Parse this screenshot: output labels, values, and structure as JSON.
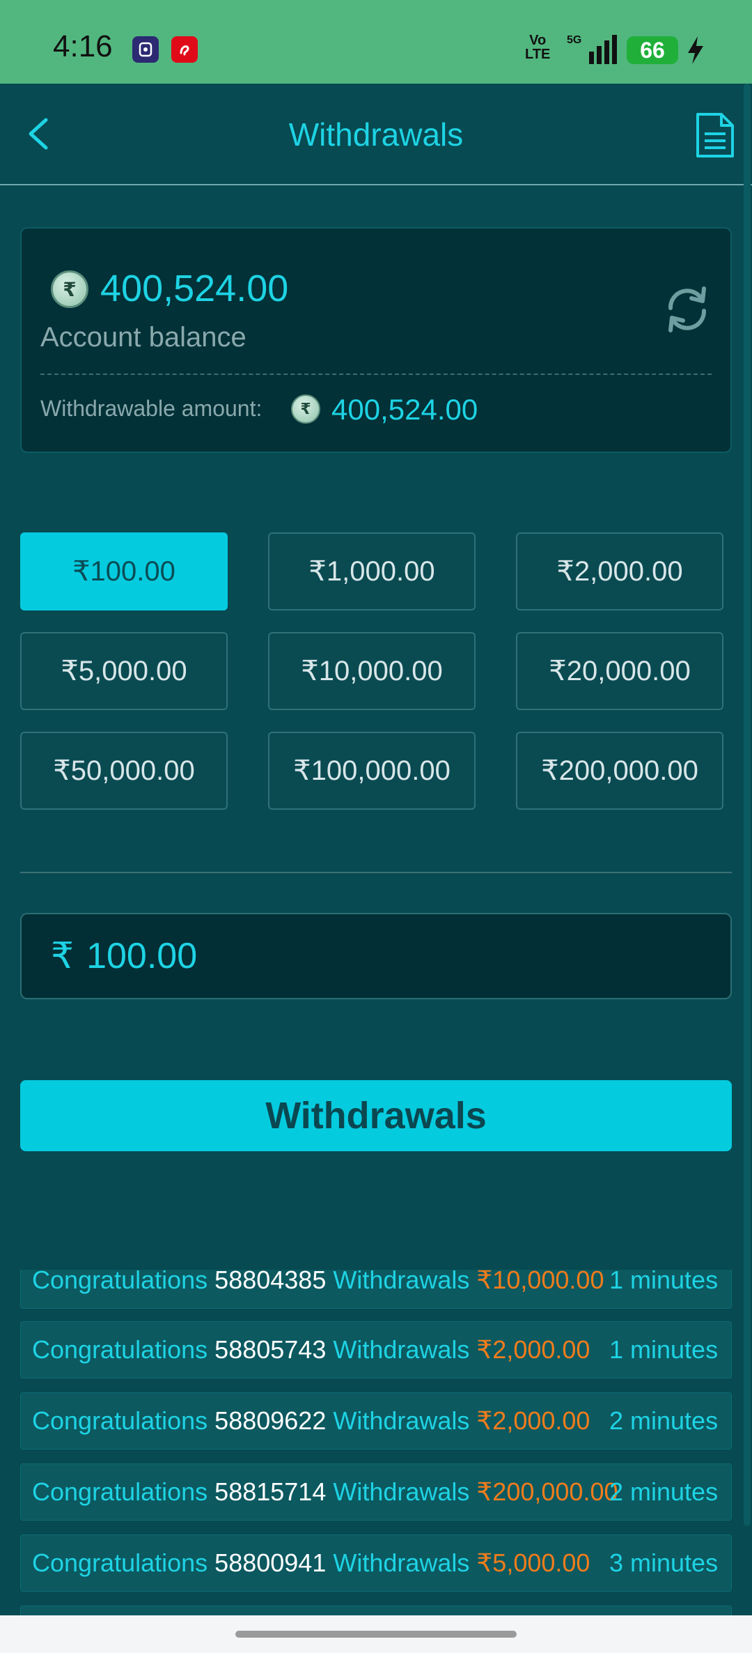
{
  "status_bar": {
    "time": "4:16",
    "apps": [
      "Jar",
      "airtel"
    ],
    "network": "Vo LTE",
    "signal": "5G",
    "battery": "66"
  },
  "header": {
    "title": "Withdrawals",
    "back_icon": "chevron-left-icon",
    "records_icon": "document-icon"
  },
  "balance": {
    "currency_symbol": "₹",
    "value": "400,524.00",
    "label": "Account balance",
    "withdrawable_label": "Withdrawable amount:",
    "withdrawable_value": "400,524.00"
  },
  "amount_options": [
    {
      "label": "₹100.00",
      "selected": true
    },
    {
      "label": "₹1,000.00",
      "selected": false
    },
    {
      "label": "₹2,000.00",
      "selected": false
    },
    {
      "label": "₹5,000.00",
      "selected": false
    },
    {
      "label": "₹10,000.00",
      "selected": false
    },
    {
      "label": "₹20,000.00",
      "selected": false
    },
    {
      "label": "₹50,000.00",
      "selected": false
    },
    {
      "label": "₹100,000.00",
      "selected": false
    },
    {
      "label": "₹200,000.00",
      "selected": false
    }
  ],
  "amount_input": {
    "currency_symbol": "₹",
    "value": "100.00"
  },
  "withdraw_button": "Withdrawals",
  "ticker": [
    {
      "prefix": "Congratulations",
      "id": "58804385",
      "action": "Withdrawals",
      "amount": "₹10,000.00",
      "time": "1 minutes"
    },
    {
      "prefix": "Congratulations",
      "id": "58805743",
      "action": "Withdrawals",
      "amount": "₹2,000.00",
      "time": "1 minutes"
    },
    {
      "prefix": "Congratulations",
      "id": "58809622",
      "action": "Withdrawals",
      "amount": "₹2,000.00",
      "time": "2 minutes"
    },
    {
      "prefix": "Congratulations",
      "id": "58815714",
      "action": "Withdrawals",
      "amount": "₹200,000.00",
      "time": "2 minutes"
    },
    {
      "prefix": "Congratulations",
      "id": "58800941",
      "action": "Withdrawals",
      "amount": "₹5,000.00",
      "time": "3 minutes"
    }
  ],
  "colors": {
    "background": "#074a51",
    "accent": "#05cbdf",
    "amount_orange": "#f07c1c",
    "status_bar": "#52b77f"
  }
}
